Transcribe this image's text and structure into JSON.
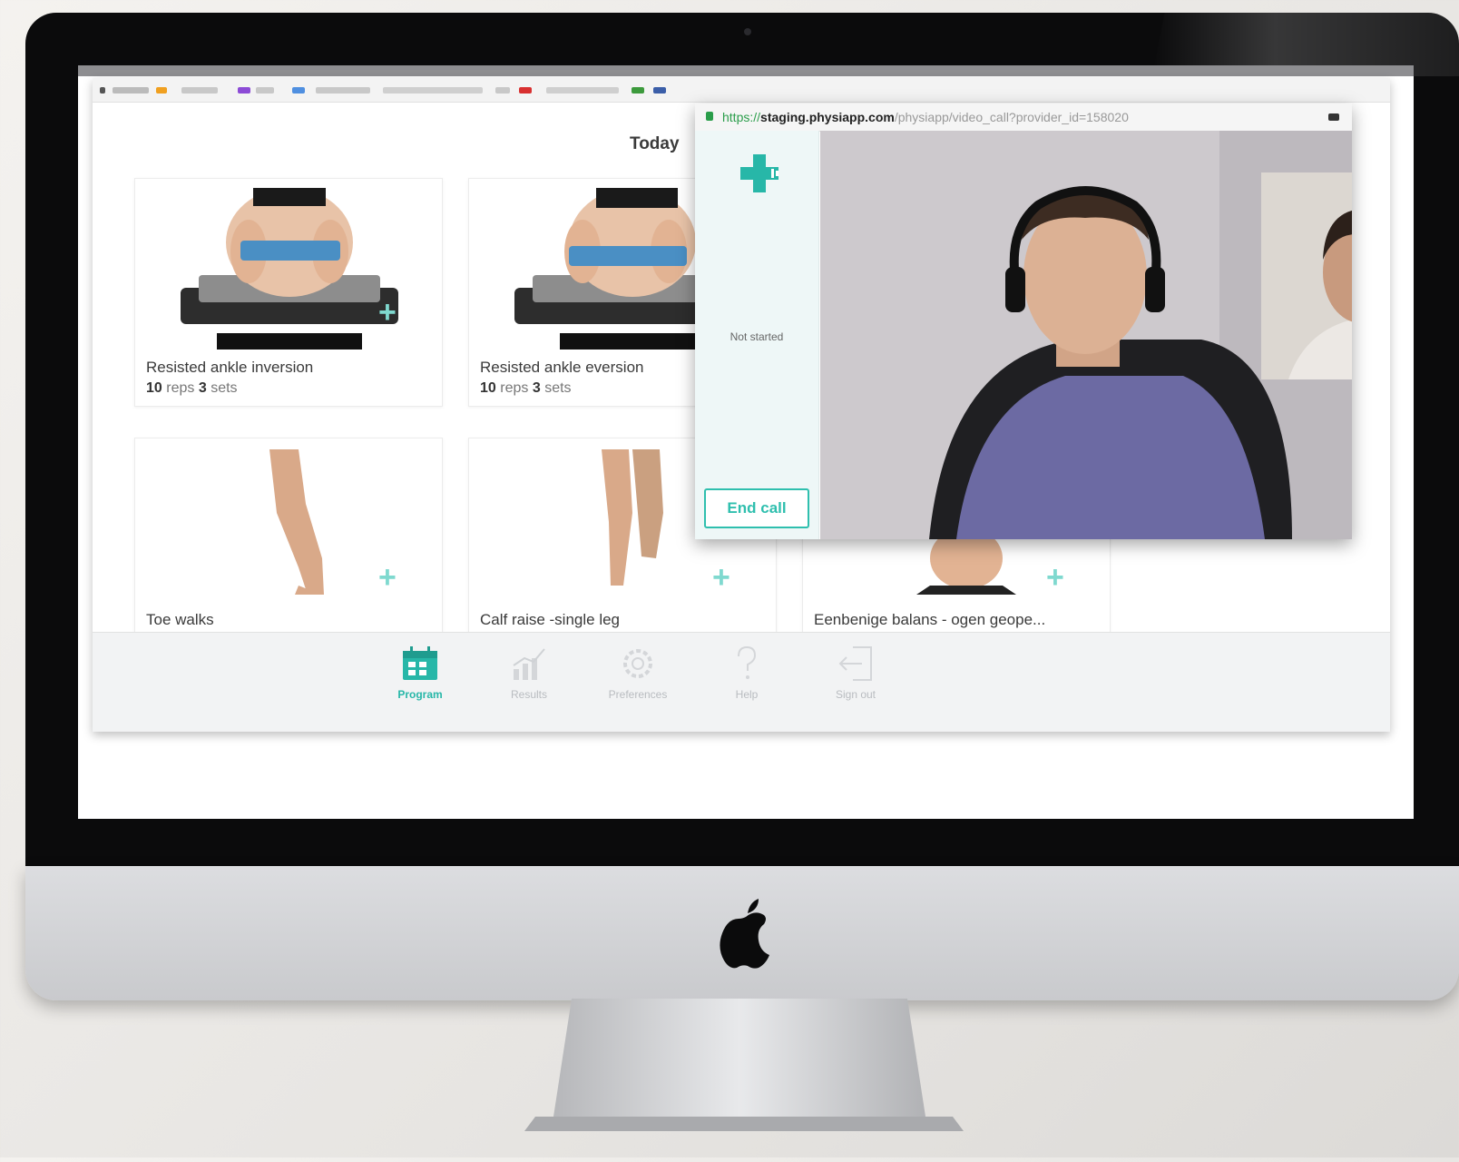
{
  "browser_popup": {
    "url_protocol": "https://",
    "url_host": "staging.physiapp.com",
    "url_path": "/physiapp/video_call?provider_id=158020"
  },
  "call": {
    "status": "Not started",
    "end_call_label": "End call"
  },
  "main": {
    "section_title": "Today",
    "cards": [
      {
        "title": "Resisted ankle inversion",
        "reps": "10",
        "reps_unit": "reps",
        "sets": "3",
        "sets_unit": "sets"
      },
      {
        "title": "Resisted ankle eversion",
        "reps": "10",
        "reps_unit": "reps",
        "sets": "3",
        "sets_unit": "sets"
      },
      {
        "title": "Toe walks"
      },
      {
        "title": "Calf raise -single leg"
      },
      {
        "title": "Eenbenige balans - ogen geope..."
      }
    ]
  },
  "nav": {
    "items": [
      {
        "label": "Program",
        "icon": "calendar-icon",
        "active": true
      },
      {
        "label": "Results",
        "icon": "chart-icon",
        "active": false
      },
      {
        "label": "Preferences",
        "icon": "gear-icon",
        "active": false
      },
      {
        "label": "Help",
        "icon": "question-icon",
        "active": false
      },
      {
        "label": "Sign out",
        "icon": "sign-out-icon",
        "active": false
      }
    ]
  },
  "colors": {
    "accent": "#27b7a8",
    "bezel": "#0b0b0c",
    "chin": "#d2d3d6"
  }
}
